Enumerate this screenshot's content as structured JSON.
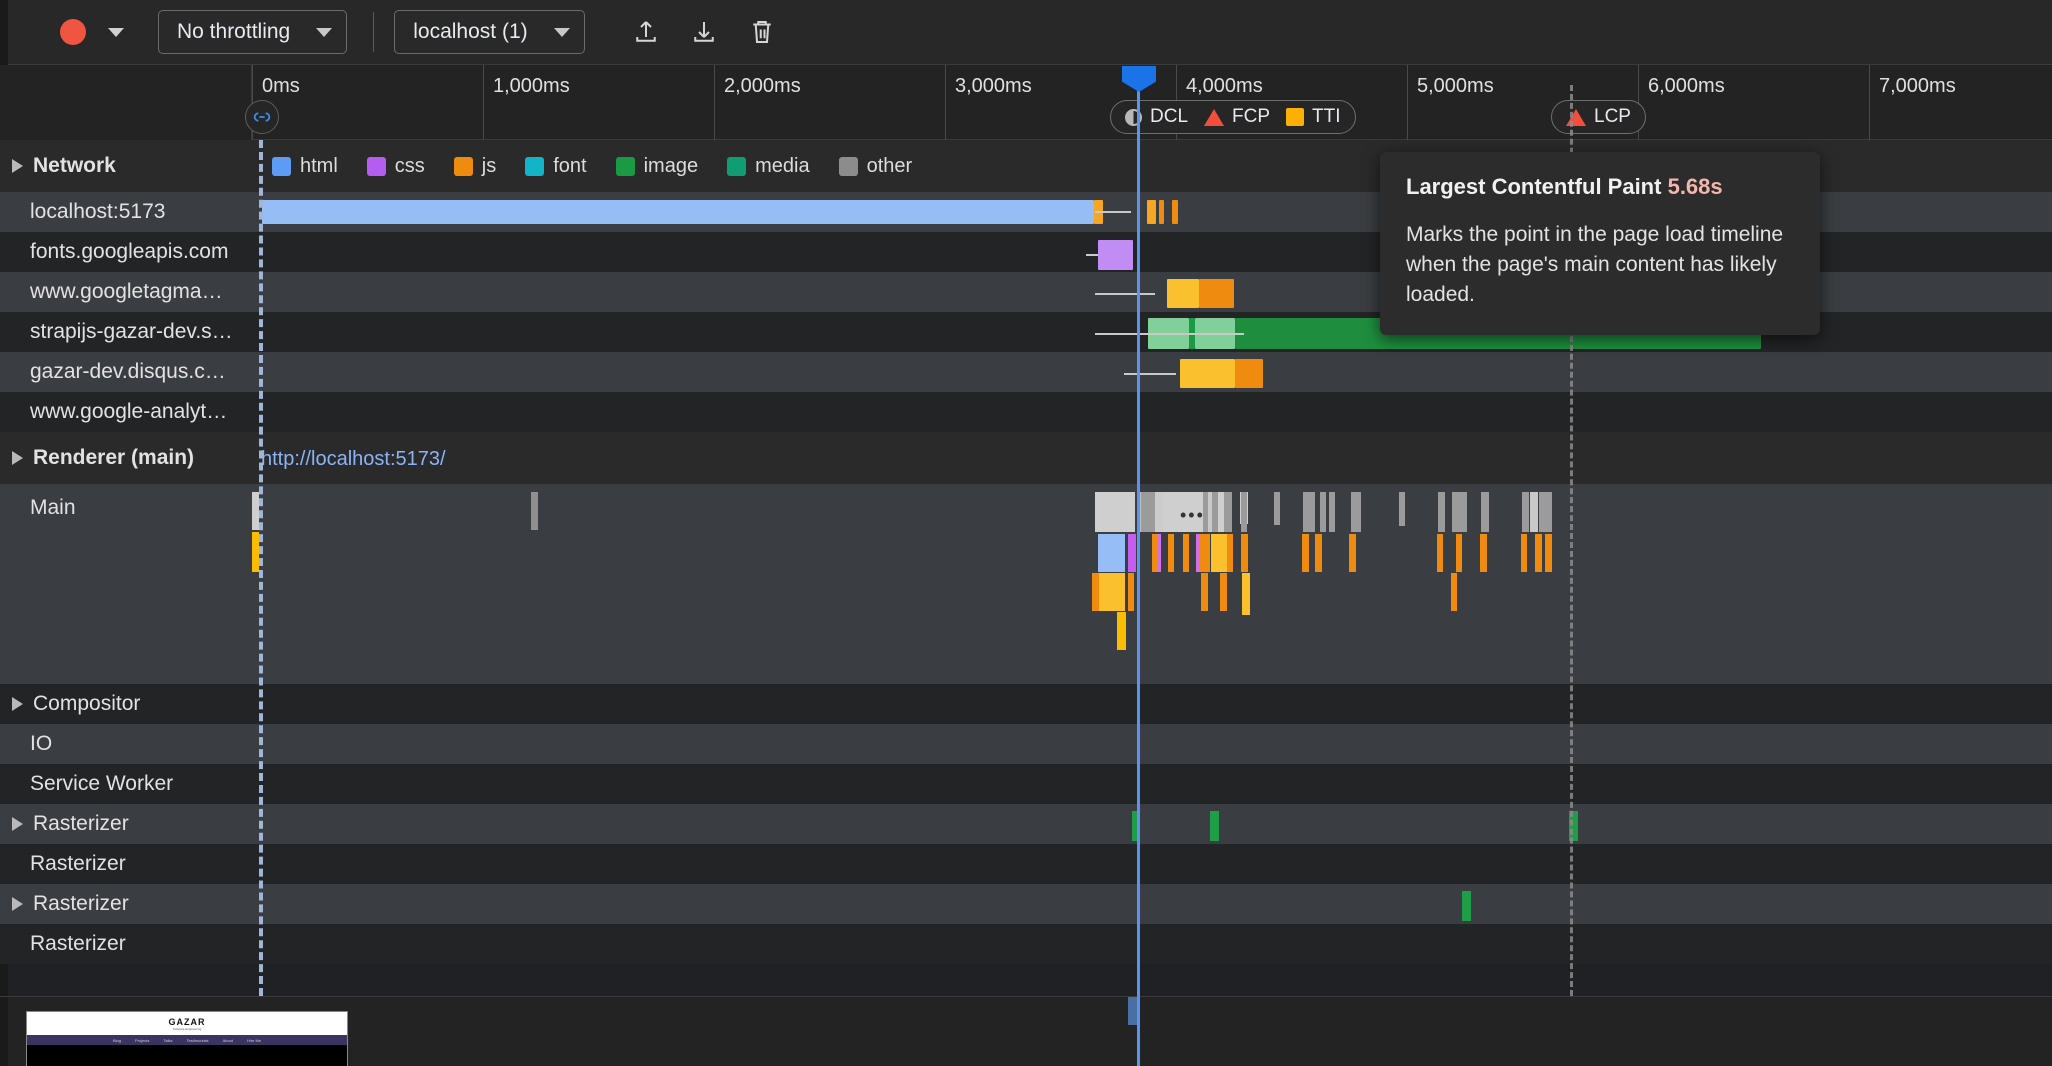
{
  "toolbar": {
    "record_label": "record-button",
    "throttling": "No throttling",
    "target": "localhost (1)",
    "icons": [
      "upload-icon",
      "download-icon",
      "trash-icon"
    ]
  },
  "ruler": {
    "ticks": [
      "0ms",
      "1,000ms",
      "2,000ms",
      "3,000ms",
      "4,000ms",
      "5,000ms",
      "6,000ms",
      "7,000ms"
    ],
    "tick_positions": [
      252,
      473,
      704,
      935,
      1166,
      1397,
      1628,
      1859
    ]
  },
  "markers": {
    "group1": [
      {
        "icon": "dcl-circle-icon",
        "label": "DCL"
      },
      {
        "icon": "fcp-triangle-icon",
        "label": "FCP"
      },
      {
        "icon": "tti-square-icon",
        "label": "TTI"
      }
    ],
    "group2": [
      {
        "icon": "lcp-triangle-icon",
        "label": "LCP"
      }
    ]
  },
  "tooltip": {
    "title": "Largest Contentful Paint",
    "value": "5.68s",
    "body": "Marks the point in the page load timeline when the page's main content has likely loaded."
  },
  "network": {
    "group_label": "Network",
    "legend": [
      {
        "label": "html",
        "color": "#5e9bf5"
      },
      {
        "label": "css",
        "color": "#b45df0"
      },
      {
        "label": "js",
        "color": "#ef8c10"
      },
      {
        "label": "font",
        "color": "#12b4c8"
      },
      {
        "label": "image",
        "color": "#1a9a44"
      },
      {
        "label": "media",
        "color": "#0f9d71"
      },
      {
        "label": "other",
        "color": "#8c8c8c"
      }
    ],
    "requests": [
      {
        "name": "localhost:5173",
        "type": "html"
      },
      {
        "name": "fonts.googleapis.com",
        "type": "css"
      },
      {
        "name": "www.googletagma…",
        "type": "js"
      },
      {
        "name": "strapijs-gazar-dev.s…",
        "type": "image"
      },
      {
        "name": "gazar-dev.disqus.c…",
        "type": "js"
      },
      {
        "name": "www.google-analyt…",
        "type": "js"
      }
    ]
  },
  "renderer": {
    "group_label": "Renderer (main)",
    "url": "http://localhost:5173/",
    "main_label": "Main"
  },
  "threads": [
    {
      "label": "Compositor",
      "group": true
    },
    {
      "label": "IO",
      "group": false
    },
    {
      "label": "Service Worker",
      "group": false
    },
    {
      "label": "Rasterizer",
      "group": true
    },
    {
      "label": "Rasterizer",
      "group": false
    },
    {
      "label": "Rasterizer",
      "group": true
    },
    {
      "label": "Rasterizer",
      "group": false
    }
  ],
  "filmstrip": {
    "site_logo": "GAZAR",
    "site_sub": "Software Engineering",
    "nav": [
      "Blog",
      "Projects",
      "Talks",
      "Testimonials",
      "About",
      "Hire Me"
    ]
  },
  "colors": {
    "accent_blue": "#1a73e8",
    "record_red": "#f05542",
    "fcp_red": "#f24e3e",
    "tti_orange": "#fbb003",
    "link_blue": "#8ab4f8",
    "bg": "#202124"
  }
}
